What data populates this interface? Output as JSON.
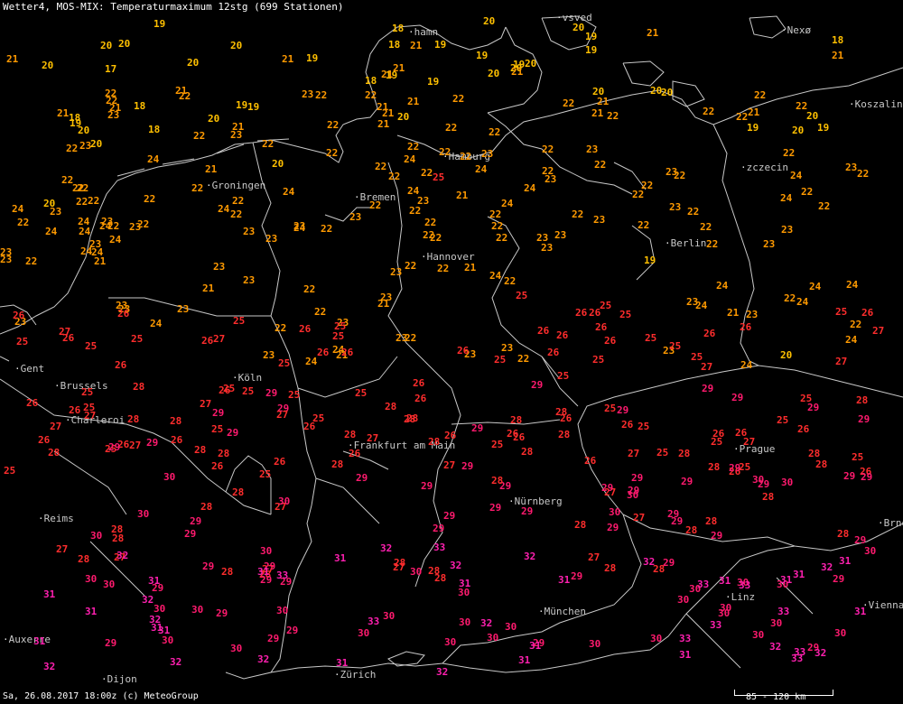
{
  "header": {
    "title": "Wetter4, MOS-MIX: Temperaturmaximum 12stg (699 Stationen)"
  },
  "footer": {
    "timestamp": "Sa, 26.08.2017 18:00z (c) MeteoGroup",
    "scale_label": "85 - 120 km"
  },
  "colors": {
    "background": "#000000",
    "border": "#c8c8c8",
    "t_17_20": "#ffc000",
    "t_21_24": "#ff9a00",
    "t_25_28": "#ff2d2d",
    "t_29_30": "#ff1a6e",
    "t_31_33": "#ff20b0"
  },
  "cities": [
    {
      "name": "Kopenhamn",
      "label": "hamn"
    },
    {
      "name": "Helsingborg",
      "label": "vsved"
    },
    {
      "name": "Nexø",
      "label": "Nexø"
    },
    {
      "name": "Koszalin",
      "label": "Koszalin"
    },
    {
      "name": "Hamburg",
      "label": "Hamburg"
    },
    {
      "name": "Szczecin",
      "label": "zczecin"
    },
    {
      "name": "Groningen",
      "label": "Groningen"
    },
    {
      "name": "Bremen",
      "label": "Bremen"
    },
    {
      "name": "Hannover",
      "label": "Hannover"
    },
    {
      "name": "Berlin",
      "label": "Berlin"
    },
    {
      "name": "Gent",
      "label": "Gent"
    },
    {
      "name": "Brussels",
      "label": "Brussels"
    },
    {
      "name": "Köln",
      "label": "Köln"
    },
    {
      "name": "Charleroi",
      "label": "Charleroi"
    },
    {
      "name": "Frankfurt am Main",
      "label": "Frankfurt am Main"
    },
    {
      "name": "Prague",
      "label": "Prague"
    },
    {
      "name": "Nürnberg",
      "label": "Nürnberg"
    },
    {
      "name": "Reims",
      "label": "Reims"
    },
    {
      "name": "Brno",
      "label": "Brno"
    },
    {
      "name": "Linz",
      "label": "Linz"
    },
    {
      "name": "Vienna",
      "label": "Vienna"
    },
    {
      "name": "München",
      "label": "München"
    },
    {
      "name": "Auxerre",
      "label": "Auxerre"
    },
    {
      "name": "Dijon",
      "label": "Dijon"
    },
    {
      "name": "Zürich",
      "label": "Zürich"
    }
  ],
  "temperatures": [
    "19",
    "20",
    "19",
    "18",
    "19",
    "19",
    "20",
    "19",
    "19",
    "20",
    "19",
    "19",
    "17",
    "18",
    "18",
    "19",
    "18",
    "18",
    "19",
    "18",
    "19",
    "19",
    "20",
    "21",
    "20",
    "20",
    "20",
    "18",
    "20",
    "20",
    "21",
    "21",
    "21",
    "21",
    "20",
    "21",
    "19",
    "19",
    "20",
    "20",
    "20",
    "21",
    "20",
    "21",
    "21",
    "21",
    "20",
    "20",
    "20",
    "21",
    "21",
    "20",
    "21",
    "22",
    "23",
    "22",
    "22",
    "22",
    "22",
    "21",
    "22",
    "20",
    "20",
    "23",
    "22",
    "21",
    "22",
    "21",
    "22",
    "20",
    "23",
    "22",
    "22",
    "22",
    "23",
    "22",
    "22",
    "22",
    "22",
    "22",
    "23",
    "22",
    "22",
    "22",
    "22",
    "22",
    "21",
    "22",
    "22",
    "22",
    "21",
    "22",
    "23",
    "23",
    "22",
    "24",
    "23",
    "22",
    "21",
    "22",
    "21",
    "23",
    "23",
    "22",
    "22",
    "22",
    "23",
    "22",
    "22",
    "22",
    "24",
    "23",
    "22",
    "22",
    "22",
    "22",
    "22",
    "22",
    "21",
    "22",
    "22",
    "22",
    "22",
    "22",
    "19",
    "21",
    "20",
    "21",
    "22",
    "22",
    "23",
    "22",
    "23",
    "24",
    "24",
    "24",
    "23",
    "23",
    "24",
    "24",
    "24",
    "24",
    "21",
    "21",
    "23",
    "22",
    "24",
    "23",
    "23",
    "22",
    "23",
    "24",
    "24",
    "24",
    "24",
    "24",
    "24",
    "22",
    "23",
    "24",
    "25",
    "25",
    "23",
    "24",
    "23",
    "24",
    "23",
    "24",
    "24",
    "24",
    "23",
    "23",
    "22",
    "22",
    "23",
    "23",
    "24",
    "25",
    "24",
    "22",
    "23",
    "22",
    "23",
    "24",
    "22",
    "23",
    "24",
    "23",
    "22",
    "22",
    "22",
    "22",
    "22",
    "22",
    "23",
    "22",
    "21",
    "22",
    "23",
    "23",
    "24",
    "23",
    "23",
    "23",
    "22",
    "22",
    "23",
    "23",
    "21",
    "22",
    "22",
    "22",
    "23",
    "24",
    "23",
    "23",
    "24",
    "22",
    "22",
    "24",
    "25",
    "26",
    "25",
    "26",
    "26",
    "25",
    "25",
    "26",
    "26",
    "25",
    "26",
    "25",
    "25",
    "26",
    "27",
    "26",
    "25",
    "25",
    "26",
    "26",
    "27",
    "25",
    "25",
    "26",
    "26",
    "26",
    "25",
    "26",
    "25",
    "27",
    "26",
    "26",
    "25",
    "25",
    "26",
    "25",
    "26",
    "25",
    "25",
    "26",
    "26",
    "25",
    "26",
    "27",
    "26",
    "25",
    "26",
    "27",
    "25",
    "25",
    "26",
    "26",
    "26",
    "25",
    "25",
    "26",
    "25",
    "25",
    "26",
    "25",
    "26",
    "27",
    "26",
    "26",
    "27",
    "25",
    "26",
    "26",
    "26",
    "25",
    "26",
    "27",
    "26",
    "25",
    "25",
    "26",
    "25",
    "26",
    "25",
    "25",
    "26",
    "26",
    "25",
    "26",
    "26",
    "28",
    "27",
    "28",
    "29",
    "28",
    "29",
    "28",
    "27",
    "29",
    "28",
    "28",
    "27",
    "29",
    "28",
    "29",
    "28",
    "29",
    "27",
    "28",
    "29",
    "29",
    "28",
    "28",
    "27",
    "29",
    "28",
    "29",
    "28",
    "28",
    "28",
    "27",
    "29",
    "28",
    "28",
    "29",
    "29",
    "28",
    "28",
    "27",
    "29",
    "28",
    "28",
    "29",
    "28",
    "28",
    "27",
    "28",
    "28",
    "27",
    "29",
    "28",
    "29",
    "28",
    "28",
    "29",
    "27",
    "28",
    "29",
    "29",
    "28",
    "27",
    "29",
    "28",
    "28",
    "27",
    "28",
    "28",
    "29",
    "29",
    "28",
    "29",
    "27",
    "28",
    "29",
    "28",
    "29",
    "27",
    "28",
    "28",
    "30",
    "29",
    "30",
    "30",
    "30",
    "29",
    "30",
    "29",
    "30",
    "30",
    "29",
    "30",
    "29",
    "30",
    "29",
    "30",
    "30",
    "30",
    "29",
    "30",
    "30",
    "30",
    "29",
    "29",
    "30",
    "29",
    "30",
    "30",
    "29",
    "29",
    "30",
    "29",
    "30",
    "30",
    "30",
    "29",
    "30",
    "29",
    "30",
    "29",
    "30",
    "30",
    "29",
    "30",
    "30",
    "29",
    "30",
    "29",
    "30",
    "29",
    "30",
    "30",
    "29",
    "30",
    "30",
    "29",
    "30",
    "29",
    "30",
    "29",
    "31",
    "32",
    "33",
    "31",
    "32",
    "31",
    "33",
    "31",
    "31",
    "32",
    "31",
    "32",
    "33",
    "31",
    "32",
    "33",
    "31",
    "32",
    "31",
    "32",
    "33",
    "31",
    "31",
    "32",
    "31",
    "33",
    "32",
    "31",
    "32",
    "33",
    "31",
    "32",
    "33",
    "31",
    "32",
    "31",
    "33",
    "32",
    "31",
    "32",
    "31",
    "33",
    "31",
    "32"
  ]
}
